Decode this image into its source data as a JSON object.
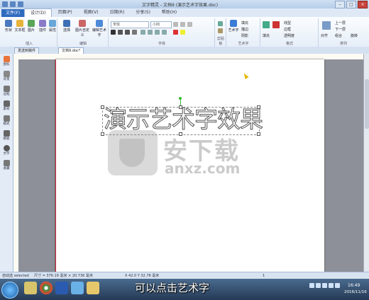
{
  "window": {
    "title": "文字精灵 - 文档9 (演示艺术字效果.doc)",
    "buttons": {
      "minimize": "–",
      "maximize": "□",
      "close": "×"
    }
  },
  "menu": {
    "file": "文件(F)",
    "tabs": [
      "设计(D)",
      "页面(P)",
      "视图(V)",
      "日期(R)",
      "分享(S)",
      "帮助(H)"
    ]
  },
  "ribbon": {
    "groups": [
      "插入",
      "编辑",
      "字体",
      "剪贴板",
      "艺术字",
      "格式",
      "排列"
    ],
    "insert": [
      "形状",
      "文本框",
      "图片",
      "插件",
      "属性"
    ],
    "edit": [
      "选择",
      "图片自定义",
      "编辑艺术字"
    ],
    "font_name": "宋体",
    "font_size": "小四",
    "wordart": [
      "艺术字",
      "填充",
      "描边",
      "阴影"
    ],
    "format": [
      "线型",
      "边框",
      "透明度",
      "填充"
    ],
    "arrange": [
      "上一层",
      "下一层",
      "对齐",
      "组合",
      "旋转"
    ]
  },
  "doc_tabs": [
    "发送到稿件",
    "文档9.doc*"
  ],
  "left_pane": [
    "图标",
    "背景",
    "边框",
    "素材",
    "模式",
    "模板",
    "文字",
    "收藏"
  ],
  "document": {
    "art_text": "演示艺术字效果",
    "watermark_title": "安下载",
    "watermark_domain": "anxz.com"
  },
  "statusbar": {
    "mode": "自动选 selected",
    "size": "尺寸 = 376.19 毫米 × 20.736 毫米",
    "position": "X 42.0 Y 32.78 毫米",
    "page": "1"
  },
  "subtitle": "可以点击艺术字",
  "clock": {
    "time": "16:49",
    "date": "2016/11/16"
  }
}
